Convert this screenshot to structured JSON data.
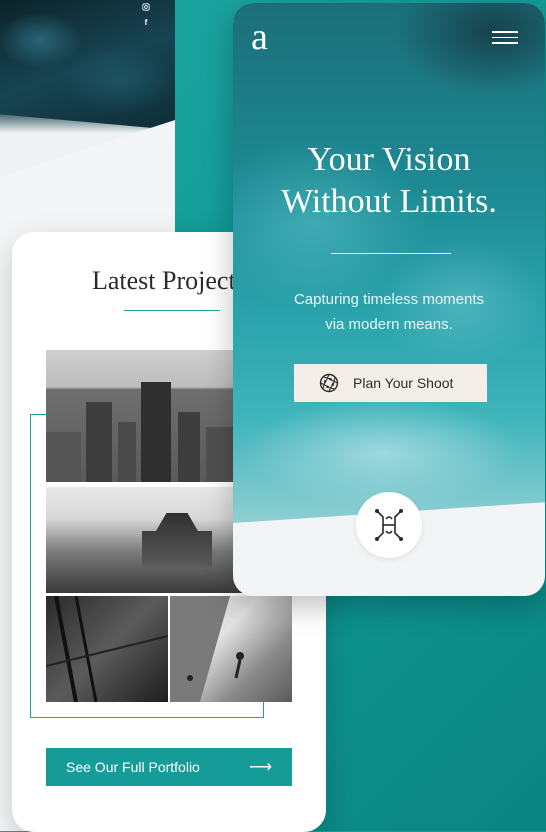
{
  "social": {
    "instagram_icon": "instagram-icon",
    "facebook_label": "f"
  },
  "projects": {
    "title": "Latest Projects",
    "button_label": "See Our Full Portfolio",
    "button_arrow": "⟶"
  },
  "hero": {
    "logo": "a",
    "title_line1": "Your Vision",
    "title_line2": "Without Limits.",
    "subtitle_line1": "Capturing timeless moments",
    "subtitle_line2": "via modern means.",
    "cta_label": "Plan Your Shoot"
  },
  "colors": {
    "accent": "#169c98",
    "cta_bg": "#f3efe8",
    "background": "#0f9a96"
  }
}
